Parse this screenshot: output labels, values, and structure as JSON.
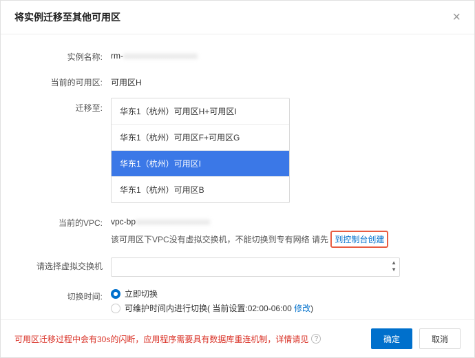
{
  "header": {
    "title": "将实例迁移至其他可用区"
  },
  "form": {
    "instance": {
      "label": "实例名称:",
      "prefix": "rm-",
      "masked": "xxxxxxxxxxxxxxxxxx"
    },
    "currentZone": {
      "label": "当前的可用区:",
      "value": "可用区H"
    },
    "migrateTo": {
      "label": "迁移至:",
      "options": [
        "华东1（杭州）可用区H+可用区I",
        "华东1（杭州）可用区F+可用区G",
        "华东1（杭州）可用区I",
        "华东1（杭州）可用区B"
      ],
      "selectedIndex": 2
    },
    "currentVpc": {
      "label": "当前的VPC:",
      "prefix": "vpc-bp",
      "masked": "xxxxxxxxxxxxxxxxxx",
      "hint_prefix": "该可用区下VPC没有虚拟交换机，不能切换到专有网络   请先",
      "hint_link": "到控制台创建"
    },
    "vswitch": {
      "label": "请选择虚拟交换机"
    },
    "switchTime": {
      "label": "切换时间:",
      "nowLabel": "立即切换",
      "maintLabel": "可维护时间内进行切换",
      "currentSettingPrefix": "( 当前设置: ",
      "currentSettingValue": "02:00-06:00",
      "modifyLink": "修改",
      "currentSettingSuffix": " )"
    }
  },
  "footer": {
    "warning": "可用区迁移过程中会有30s的闪断，应用程序需要具有数据库重连机制，详情请见",
    "confirm": "确定",
    "cancel": "取消"
  }
}
